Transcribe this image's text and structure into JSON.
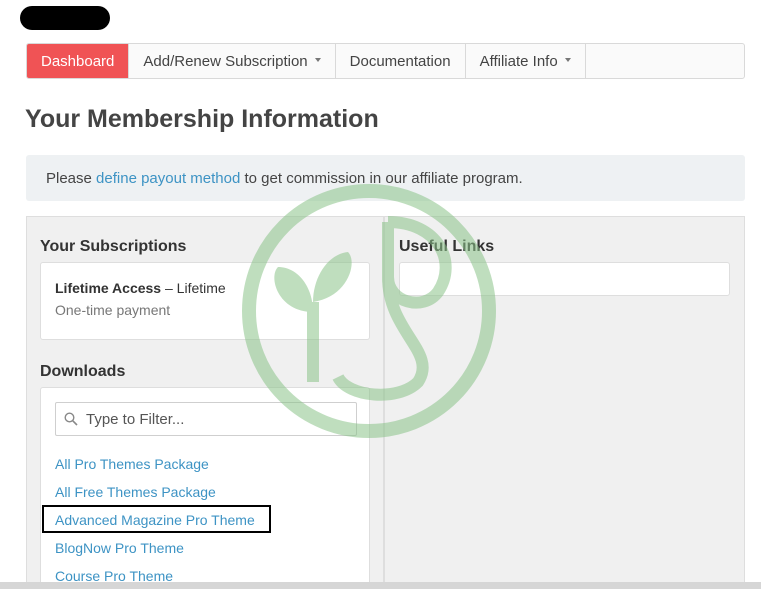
{
  "nav": {
    "items": [
      {
        "label": "Dashboard",
        "active": true,
        "has_caret": false
      },
      {
        "label": "Add/Renew Subscription",
        "active": false,
        "has_caret": true
      },
      {
        "label": "Documentation",
        "active": false,
        "has_caret": false
      },
      {
        "label": "Affiliate Info",
        "active": false,
        "has_caret": true
      }
    ]
  },
  "page": {
    "title": "Your Membership Information"
  },
  "notice": {
    "prefix": "Please ",
    "link_text": "define payout method",
    "suffix": " to get commission in our affiliate program."
  },
  "subscriptions": {
    "heading": "Your Subscriptions",
    "plan_name": "Lifetime Access",
    "plan_sep": " – ",
    "plan_duration": "Lifetime",
    "payment_type": "One-time payment"
  },
  "useful_links": {
    "heading": "Useful Links"
  },
  "downloads": {
    "heading": "Downloads",
    "filter_placeholder": "Type to Filter...",
    "items": [
      "All Pro Themes Package",
      "All Free Themes Package",
      "Advanced Magazine Pro Theme",
      "BlogNow Pro Theme",
      "Course Pro Theme"
    ]
  },
  "colors": {
    "active_tab": "#f05355",
    "link": "#3d93c4",
    "watermark_green": "#8bc48a"
  }
}
